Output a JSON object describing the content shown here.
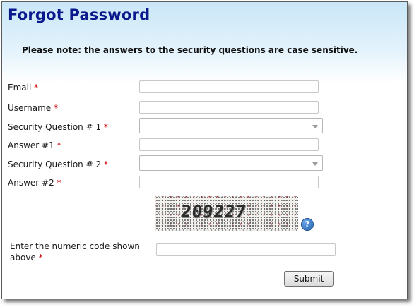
{
  "title": "Forgot Password",
  "note": "Please note: the answers to the security questions are case sensitive.",
  "required_marker": "*",
  "fields": {
    "email": {
      "label": "Email",
      "value": ""
    },
    "username": {
      "label": "Username",
      "value": ""
    },
    "security_question_1": {
      "label": "Security Question # 1",
      "selected": ""
    },
    "answer_1": {
      "label": "Answer #1",
      "value": ""
    },
    "security_question_2": {
      "label": "Security Question # 2",
      "selected": ""
    },
    "answer_2": {
      "label": "Answer #2",
      "value": ""
    }
  },
  "captcha": {
    "code": "209227",
    "help_icon": "question-icon",
    "help_glyph": "?",
    "label_line1": "Enter the numeric code shown",
    "label_line2": "above",
    "value": ""
  },
  "submit_label": "Submit",
  "colors": {
    "title": "#0a1a8c",
    "required": "#cc0000",
    "header_gradient_top": "#c9e6f7"
  }
}
